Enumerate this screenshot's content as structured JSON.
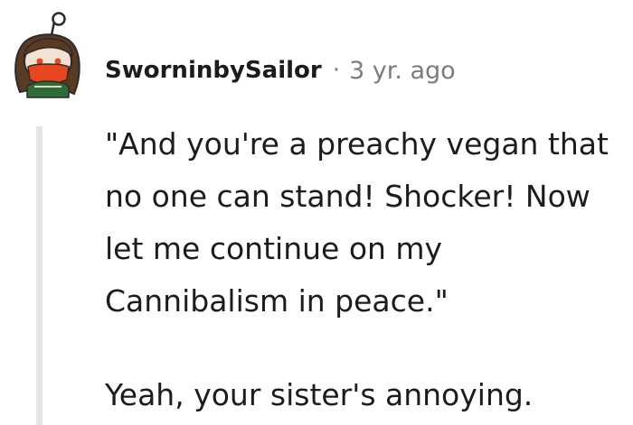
{
  "comment": {
    "username": "SworninbySailor",
    "separator": "·",
    "timestamp": "3 yr. ago",
    "body": [
      "\"And you're a preachy vegan that no one can stand! Shocker! Now let me continue on my Cannibalism in peace.\"",
      "Yeah, your sister's annoying."
    ]
  },
  "colors": {
    "avatar_accent": "#e8461e",
    "scarf": "#2f6a3b",
    "hair": "#5b3a24",
    "muted_text": "#7c7c7c",
    "thread_line": "#e4e4e4"
  }
}
